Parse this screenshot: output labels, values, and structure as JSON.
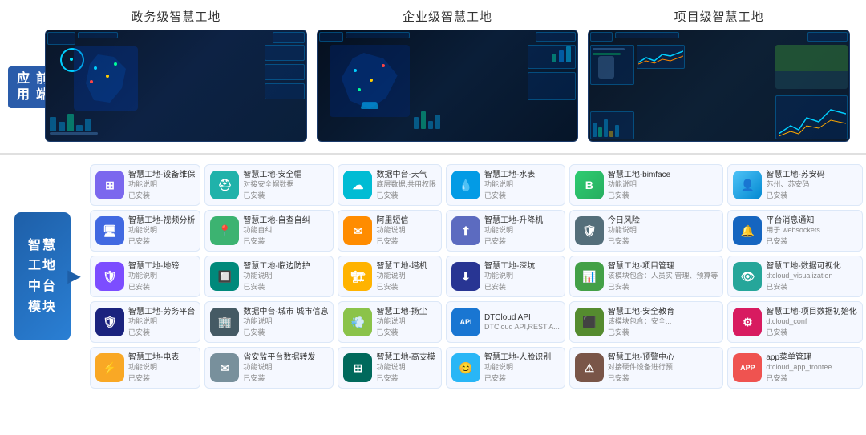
{
  "top": {
    "left_label": "应用\n前端",
    "screen_groups": [
      {
        "title": "政务级智慧工地",
        "type": "gov"
      },
      {
        "title": "企业级智慧工地",
        "type": "enterprise"
      },
      {
        "title": "项目级智慧工地",
        "type": "project"
      }
    ]
  },
  "bottom": {
    "label": "智慧\n工地\n中台\n模块",
    "modules": [
      {
        "name": "智慧工地-设备维保",
        "desc": "功能说明",
        "status": "已安装",
        "icon": "grid",
        "color": "icon-purple"
      },
      {
        "name": "智慧工地-安全帽",
        "desc": "对接安全帽数据",
        "status": "已安装",
        "icon": "helmet",
        "color": "icon-teal"
      },
      {
        "name": "数据中台-天气",
        "desc": "底层数据,共用权限",
        "status": "已安装",
        "icon": "cloud",
        "color": "icon-cyan"
      },
      {
        "name": "智慧工地-水表",
        "desc": "功能说明",
        "status": "已安装",
        "icon": "drop",
        "color": "icon-sky"
      },
      {
        "name": "智慧工地-bimface",
        "desc": "功能说明",
        "status": "已安装",
        "icon": "B",
        "color": "icon-bimface"
      },
      {
        "name": "智慧工地-苏安码",
        "desc": "苏州、苏安码",
        "status": "已安装",
        "icon": "person",
        "color": "icon-suzhoucode"
      },
      {
        "name": "智慧工地-视频分析",
        "desc": "功能说明",
        "status": "已安装",
        "icon": "monitor",
        "color": "icon-blue"
      },
      {
        "name": "智慧工地-自查自纠",
        "desc": "功能自纠",
        "status": "已安装",
        "icon": "location",
        "color": "icon-green"
      },
      {
        "name": "阿里短信",
        "desc": "功能说明",
        "status": "已安装",
        "icon": "msg",
        "color": "icon-orange"
      },
      {
        "name": "智慧工地-升降机",
        "desc": "功能说明",
        "status": "已安装",
        "icon": "elevator",
        "color": "icon-indigo"
      },
      {
        "name": "今日风险",
        "desc": "功能说明",
        "status": "已安装",
        "icon": "shield",
        "color": "icon-steel"
      },
      {
        "name": "平台消息通知",
        "desc": "用于 websockets",
        "status": "已安装",
        "icon": "bell",
        "color": "icon-cobalt"
      },
      {
        "name": "智慧工地-地磅",
        "desc": "功能说明",
        "status": "已安装",
        "icon": "shield2",
        "color": "icon-violet"
      },
      {
        "name": "智慧工地-临边防护",
        "desc": "功能说明",
        "status": "已安装",
        "icon": "fence",
        "color": "icon-emerald"
      },
      {
        "name": "智慧工地-塔机",
        "desc": "功能说明",
        "status": "已安装",
        "icon": "crane",
        "color": "icon-amber"
      },
      {
        "name": "智慧工地-深坑",
        "desc": "功能说明",
        "status": "已安装",
        "icon": "pit",
        "color": "icon-deep"
      },
      {
        "name": "智慧工地-项目管理",
        "desc": "该模块包含：人员实\n管理、预算等",
        "status": "已安装",
        "icon": "chart",
        "color": "icon-grass"
      },
      {
        "name": "智慧工地-数据可视化",
        "desc": "dtcloud_visualization",
        "status": "已安装",
        "icon": "eye",
        "color": "icon-mint"
      },
      {
        "name": "智慧工地-劳务平台",
        "desc": "功能说明",
        "status": "已安装",
        "icon": "shield3",
        "color": "icon-navy"
      },
      {
        "name": "数据中台-城市\n城市信息",
        "desc": "功能说明",
        "status": "已安装",
        "icon": "building",
        "color": "icon-slate"
      },
      {
        "name": "智慧工地-扬尘",
        "desc": "功能说明",
        "status": "已安装",
        "icon": "dust",
        "color": "icon-lime"
      },
      {
        "name": "DTCloud API",
        "desc": "DTCloud API,REST A...",
        "status": "",
        "icon": "API",
        "color": "icon-api"
      },
      {
        "name": "智慧工地-安全教育",
        "desc": "该模块包含：安全...",
        "status": "已安装",
        "icon": "layers",
        "color": "icon-olive"
      },
      {
        "name": "智慧工地-项目数据初始化",
        "desc": "dtcloud_conf",
        "status": "已安装",
        "icon": "gear",
        "color": "icon-rose"
      },
      {
        "name": "智慧工地-电表",
        "desc": "功能说明",
        "status": "已安装",
        "icon": "lightning",
        "color": "icon-yellow"
      },
      {
        "name": "省安监平台数据转发",
        "desc": "功能说明",
        "status": "已安装",
        "icon": "envelope",
        "color": "icon-gray"
      },
      {
        "name": "智慧工地-高支模",
        "desc": "功能说明",
        "status": "已安装",
        "icon": "grid2",
        "color": "icon-dark-teal"
      },
      {
        "name": "智慧工地-人脸识别",
        "desc": "功能说明",
        "status": "已安装",
        "icon": "face",
        "color": "icon-light-blue"
      },
      {
        "name": "智慧工地-预警中心",
        "desc": "对接硬件设备进行预...",
        "status": "已安装",
        "icon": "warn",
        "color": "icon-brown"
      },
      {
        "name": "app菜单管理",
        "desc": "dtcloud_app_frontee",
        "status": "已安装",
        "icon": "APP",
        "color": "icon-app"
      }
    ]
  }
}
